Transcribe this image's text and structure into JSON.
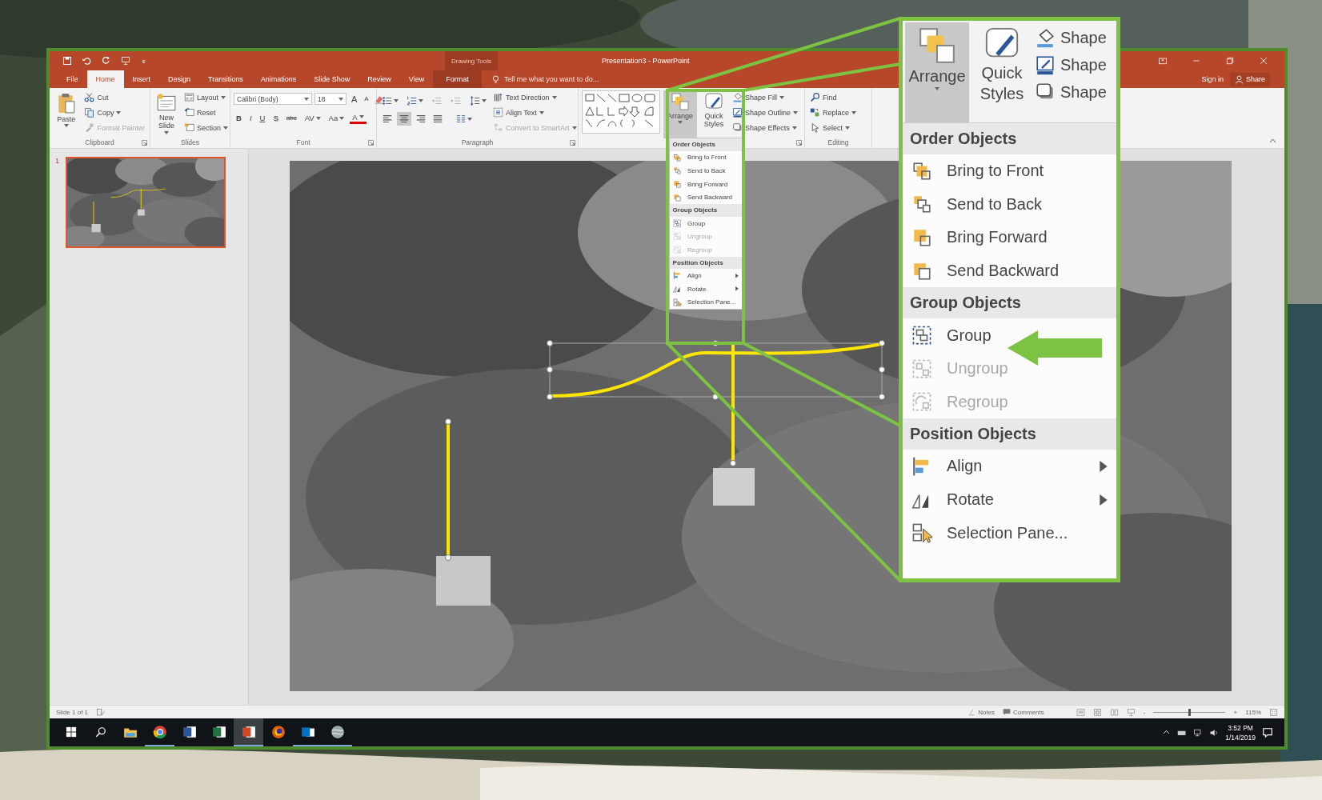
{
  "window": {
    "context_label": "Drawing Tools",
    "title": "Presentation3 - PowerPoint"
  },
  "tabs": [
    {
      "label": "File",
      "selected": false,
      "contextual": false
    },
    {
      "label": "Home",
      "selected": true,
      "contextual": false
    },
    {
      "label": "Insert",
      "selected": false,
      "contextual": false
    },
    {
      "label": "Design",
      "selected": false,
      "contextual": false
    },
    {
      "label": "Transitions",
      "selected": false,
      "contextual": false
    },
    {
      "label": "Animations",
      "selected": false,
      "contextual": false
    },
    {
      "label": "Slide Show",
      "selected": false,
      "contextual": false
    },
    {
      "label": "Review",
      "selected": false,
      "contextual": false
    },
    {
      "label": "View",
      "selected": false,
      "contextual": false
    },
    {
      "label": "Format",
      "selected": false,
      "contextual": true
    }
  ],
  "tell_me": {
    "placeholder": "Tell me what you want to do..."
  },
  "account": {
    "sign_in": "Sign in",
    "share": "Share"
  },
  "ribbon": {
    "groups": [
      {
        "kind": "clipboard",
        "label": "Clipboard",
        "launcher": true,
        "paste": "Paste",
        "items": [
          {
            "label": "Cut",
            "disabled": false,
            "dropdown": false
          },
          {
            "label": "Copy",
            "disabled": false,
            "dropdown": true
          },
          {
            "label": "Format Painter",
            "disabled": true,
            "dropdown": false
          }
        ]
      },
      {
        "kind": "slides",
        "label": "Slides",
        "launcher": false,
        "new_slide": "New Slide",
        "items": [
          {
            "label": "Layout",
            "disabled": false,
            "dropdown": true
          },
          {
            "label": "Reset",
            "disabled": false,
            "dropdown": false
          },
          {
            "label": "Section",
            "disabled": false,
            "dropdown": true
          }
        ]
      },
      {
        "kind": "font",
        "label": "Font",
        "launcher": true,
        "font": {
          "value": "Calibri (Body)"
        },
        "size": {
          "value": "18"
        },
        "grow": "A",
        "shrink": "A",
        "buttons": [
          {
            "label": "B",
            "dropdown": false
          },
          {
            "label": "I",
            "dropdown": false
          },
          {
            "label": "U",
            "dropdown": false
          },
          {
            "label": "S",
            "dropdown": false
          },
          {
            "label": "abc",
            "dropdown": false
          },
          {
            "label": "AV",
            "dropdown": true
          },
          {
            "label": "Aa",
            "dropdown": true
          },
          {
            "label": "A",
            "dropdown": true
          }
        ]
      },
      {
        "kind": "paragraph",
        "label": "Paragraph",
        "launcher": true,
        "alignment_buttons": [
          {
            "selected": false
          },
          {
            "selected": true
          },
          {
            "selected": false
          },
          {
            "selected": false
          }
        ],
        "items": [
          {
            "label": "Text Direction",
            "disabled": false,
            "dropdown": true
          },
          {
            "label": "Align Text",
            "disabled": false,
            "dropdown": true
          },
          {
            "label": "Convert to SmartArt",
            "disabled": true,
            "dropdown": true
          }
        ]
      },
      {
        "kind": "drawing",
        "launcher": true,
        "arrange": {
          "label": "Arrange",
          "selected": true
        },
        "quick_styles": "Quick Styles",
        "items": [
          {
            "label": "Shape Fill",
            "disabled": false,
            "dropdown": true
          },
          {
            "label": "Shape Outline",
            "disabled": false,
            "dropdown": true
          },
          {
            "label": "Shape Effects",
            "disabled": false,
            "dropdown": true
          }
        ]
      },
      {
        "kind": "editing",
        "label": "Editing",
        "launcher": false,
        "items": [
          {
            "label": "Find",
            "disabled": false,
            "dropdown": false
          },
          {
            "label": "Replace",
            "disabled": false,
            "dropdown": true
          },
          {
            "label": "Select",
            "disabled": false,
            "dropdown": true
          }
        ]
      }
    ]
  },
  "arrange_menu": {
    "sections": [
      {
        "header": "Order Objects",
        "items": [
          {
            "kind": "front",
            "label": "Bring to Front",
            "disabled": false,
            "submenu": false
          },
          {
            "kind": "back",
            "label": "Send to Back",
            "disabled": false,
            "submenu": false
          },
          {
            "kind": "forward",
            "label": "Bring Forward",
            "disabled": false,
            "submenu": false
          },
          {
            "kind": "backward",
            "label": "Send Backward",
            "disabled": false,
            "submenu": false
          }
        ]
      },
      {
        "header": "Group Objects",
        "items": [
          {
            "kind": "group",
            "label": "Group",
            "disabled": false,
            "submenu": false
          },
          {
            "kind": "ungroup",
            "label": "Ungroup",
            "disabled": true,
            "submenu": false
          },
          {
            "kind": "regroup",
            "label": "Regroup",
            "disabled": true,
            "submenu": false
          }
        ]
      },
      {
        "header": "Position Objects",
        "items": [
          {
            "kind": "align",
            "label": "Align",
            "disabled": false,
            "submenu": true
          },
          {
            "kind": "rotate",
            "label": "Rotate",
            "disabled": false,
            "submenu": true
          },
          {
            "kind": "selection",
            "label": "Selection Pane...",
            "disabled": false,
            "submenu": false
          }
        ]
      }
    ]
  },
  "slides_pane": {
    "thumbnails": [
      {
        "number": "1",
        "selected": true
      }
    ]
  },
  "callout": {
    "arrange": {
      "label": "Arrange",
      "selected": true
    },
    "quick_styles": "Quick Styles",
    "shape_items": [
      "Shape",
      "Shape",
      "Shape"
    ],
    "menu": {
      "sections": [
        {
          "header": "Order Objects",
          "items": [
            {
              "kind": "front",
              "label": "Bring to Front",
              "disabled": false,
              "submenu": false
            },
            {
              "kind": "back",
              "label": "Send to Back",
              "disabled": false,
              "submenu": false
            },
            {
              "kind": "forward",
              "label": "Bring Forward",
              "disabled": false,
              "submenu": false
            },
            {
              "kind": "backward",
              "label": "Send Backward",
              "disabled": false,
              "submenu": false
            }
          ]
        },
        {
          "header": "Group Objects",
          "items": [
            {
              "kind": "group",
              "label": "Group",
              "disabled": false,
              "submenu": false
            },
            {
              "kind": "ungroup",
              "label": "Ungroup",
              "disabled": true,
              "submenu": false
            },
            {
              "kind": "regroup",
              "label": "Regroup",
              "disabled": true,
              "submenu": false
            }
          ]
        },
        {
          "header": "Position Objects",
          "items": [
            {
              "kind": "align",
              "label": "Align",
              "disabled": false,
              "submenu": true
            },
            {
              "kind": "rotate",
              "label": "Rotate",
              "disabled": false,
              "submenu": true
            },
            {
              "kind": "selection",
              "label": "Selection Pane...",
              "disabled": false,
              "submenu": false
            }
          ]
        }
      ]
    }
  },
  "status_bar": {
    "slide_info": "Slide 1 of 1",
    "notes": "Notes",
    "comments": "Comments",
    "zoom": {
      "minus": "-",
      "plus": "+",
      "level": 0.5,
      "reading": "115%"
    }
  },
  "taskbar": {
    "apps": [
      {
        "kind": "files",
        "running": false,
        "selected": false
      },
      {
        "kind": "chrome",
        "running": true,
        "selected": false
      },
      {
        "kind": "word",
        "running": false,
        "selected": false
      },
      {
        "kind": "excel",
        "running": false,
        "selected": false
      },
      {
        "kind": "powerpoint",
        "running": true,
        "selected": true
      },
      {
        "kind": "firefox",
        "running": false,
        "selected": false
      },
      {
        "kind": "outlook",
        "running": true,
        "selected": false
      },
      {
        "kind": "earth",
        "running": true,
        "selected": false
      }
    ],
    "clock": {
      "time": "3:52 PM",
      "date": "1/14/2019"
    }
  }
}
